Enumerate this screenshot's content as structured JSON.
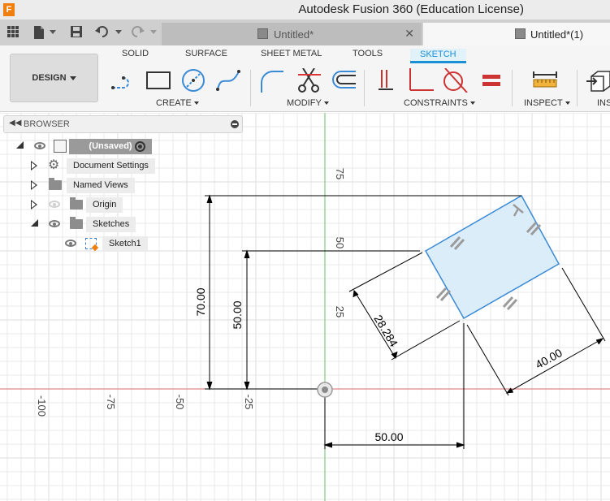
{
  "window": {
    "title": "Autodesk Fusion 360 (Education License)",
    "app_logo": "F"
  },
  "quickbar": {
    "icons": [
      "grid-icon",
      "file-icon",
      "save-icon",
      "undo-icon",
      "redo-icon"
    ]
  },
  "document_tabs": [
    {
      "label": "Untitled*",
      "active": false
    },
    {
      "label": "Untitled*(1)",
      "active": true
    }
  ],
  "toolbar": {
    "workspace": "DESIGN",
    "tabs": [
      "SOLID",
      "SURFACE",
      "SHEET METAL",
      "TOOLS",
      "SKETCH"
    ],
    "active_tab": "SKETCH",
    "groups": [
      "CREATE",
      "MODIFY",
      "CONSTRAINTS",
      "INSPECT",
      "INS"
    ],
    "accent_color": "#1a8fd6"
  },
  "browser": {
    "header": "BROWSER",
    "root": "(Unsaved)",
    "items": [
      {
        "label": "Document Settings",
        "icon": "gear-icon"
      },
      {
        "label": "Named Views",
        "icon": "folder-icon"
      },
      {
        "label": "Origin",
        "icon": "folder-icon"
      },
      {
        "label": "Sketches",
        "icon": "folder-icon"
      },
      {
        "label": "Sketch1",
        "icon": "sketch-icon"
      }
    ]
  },
  "canvas": {
    "axis_labels": {
      "vertical": [
        "75",
        "50",
        "25"
      ],
      "horizontal": [
        "-100",
        "-75",
        "-50",
        "-25"
      ]
    },
    "dimensions": [
      "70.00",
      "50.00",
      "28.284",
      "40.00",
      "50.00"
    ],
    "colors": {
      "x_axis": "#e07070",
      "y_axis": "#6cc86c",
      "profile_fill": "#dcedfa",
      "profile_edge": "#3a8ad6",
      "dimension": "#000000",
      "grid": "#e3e3e3"
    }
  }
}
